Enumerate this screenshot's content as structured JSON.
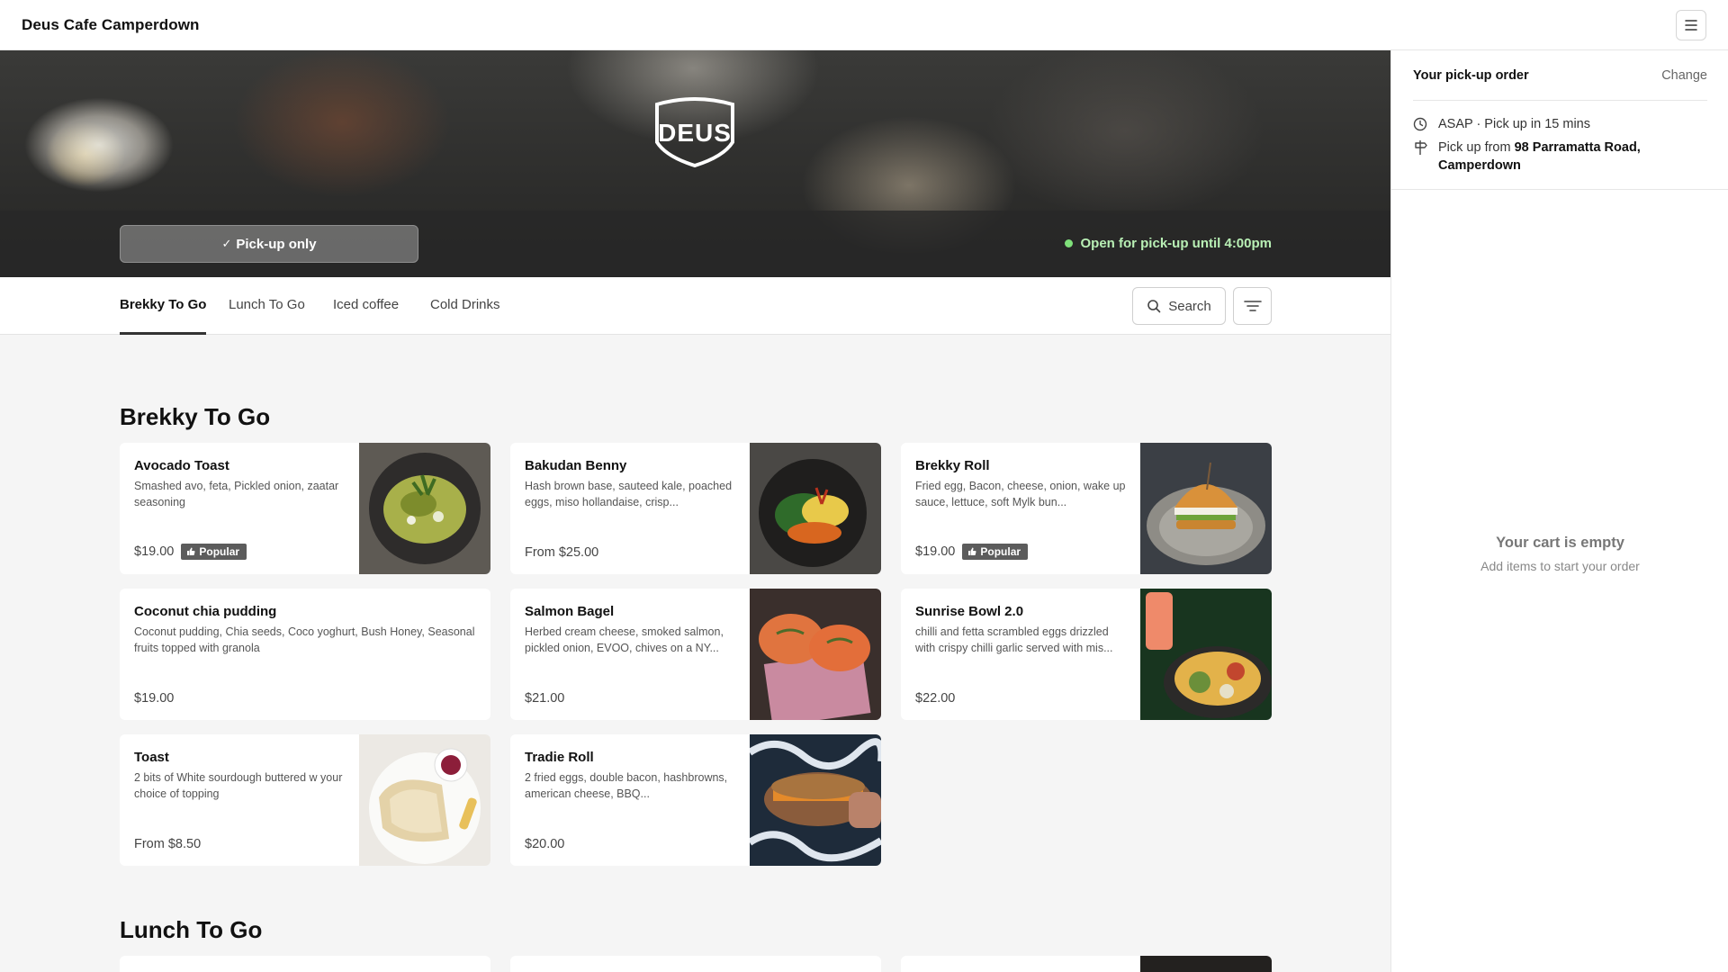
{
  "header": {
    "title": "Deus Cafe Camperdown"
  },
  "hero": {
    "brand": "DEUS",
    "pickup_label": "Pick-up only",
    "status": "Open for pick-up until 4:00pm",
    "status_color": "#7fe07a"
  },
  "tabs": [
    {
      "label": "Brekky To Go",
      "active": true
    },
    {
      "label": "Lunch To Go",
      "active": false
    },
    {
      "label": "Iced coffee",
      "active": false
    },
    {
      "label": "Cold Drinks",
      "active": false
    }
  ],
  "search": {
    "label": "Search"
  },
  "sections": [
    {
      "title": "Brekky To Go",
      "items": [
        {
          "name": "Avocado Toast",
          "desc": "Smashed avo, feta, Pickled onion, zaatar seasoning",
          "price": "$19.00",
          "badge": "Popular",
          "image": "avocado-toast-photo"
        },
        {
          "name": "Bakudan Benny",
          "desc": "Hash brown base, sauteed kale, poached eggs, miso hollandaise, crisp...",
          "price": "From $25.00",
          "badge": "",
          "image": "bakudan-benny-photo"
        },
        {
          "name": "Brekky Roll",
          "desc": "Fried egg, Bacon, cheese, onion, wake up sauce, lettuce, soft Mylk bun...",
          "price": "$19.00",
          "badge": "Popular",
          "image": "brekky-roll-photo"
        },
        {
          "name": "Coconut chia pudding",
          "desc": "Coconut pudding, Chia seeds, Coco yoghurt, Bush Honey, Seasonal fruits topped with granola",
          "price": "$19.00",
          "badge": "",
          "image": ""
        },
        {
          "name": "Salmon Bagel",
          "desc": "Herbed cream cheese, smoked salmon, pickled onion, EVOO, chives on a NY...",
          "price": "$21.00",
          "badge": "",
          "image": "salmon-bagel-photo"
        },
        {
          "name": "Sunrise Bowl 2.0",
          "desc": "chilli and fetta scrambled eggs drizzled with crispy chilli garlic served with mis...",
          "price": "$22.00",
          "badge": "",
          "image": "sunrise-bowl-photo"
        },
        {
          "name": "Toast",
          "desc": "2 bits of White sourdough buttered w your choice of topping",
          "price": "From $8.50",
          "badge": "",
          "image": "toast-photo"
        },
        {
          "name": "Tradie Roll",
          "desc": "2 fried eggs, double bacon, hashbrowns, american cheese, BBQ...",
          "price": "$20.00",
          "badge": "",
          "image": "tradie-roll-photo"
        }
      ]
    },
    {
      "title": "Lunch To Go",
      "items": []
    }
  ],
  "sidebar": {
    "heading": "Your pick-up order",
    "change": "Change",
    "time": "ASAP · Pick up in 15 mins",
    "pickup_prefix": "Pick up from ",
    "address": "98 Parramatta Road, Camperdown",
    "empty_title": "Your cart is empty",
    "empty_sub": "Add items to start your order"
  }
}
